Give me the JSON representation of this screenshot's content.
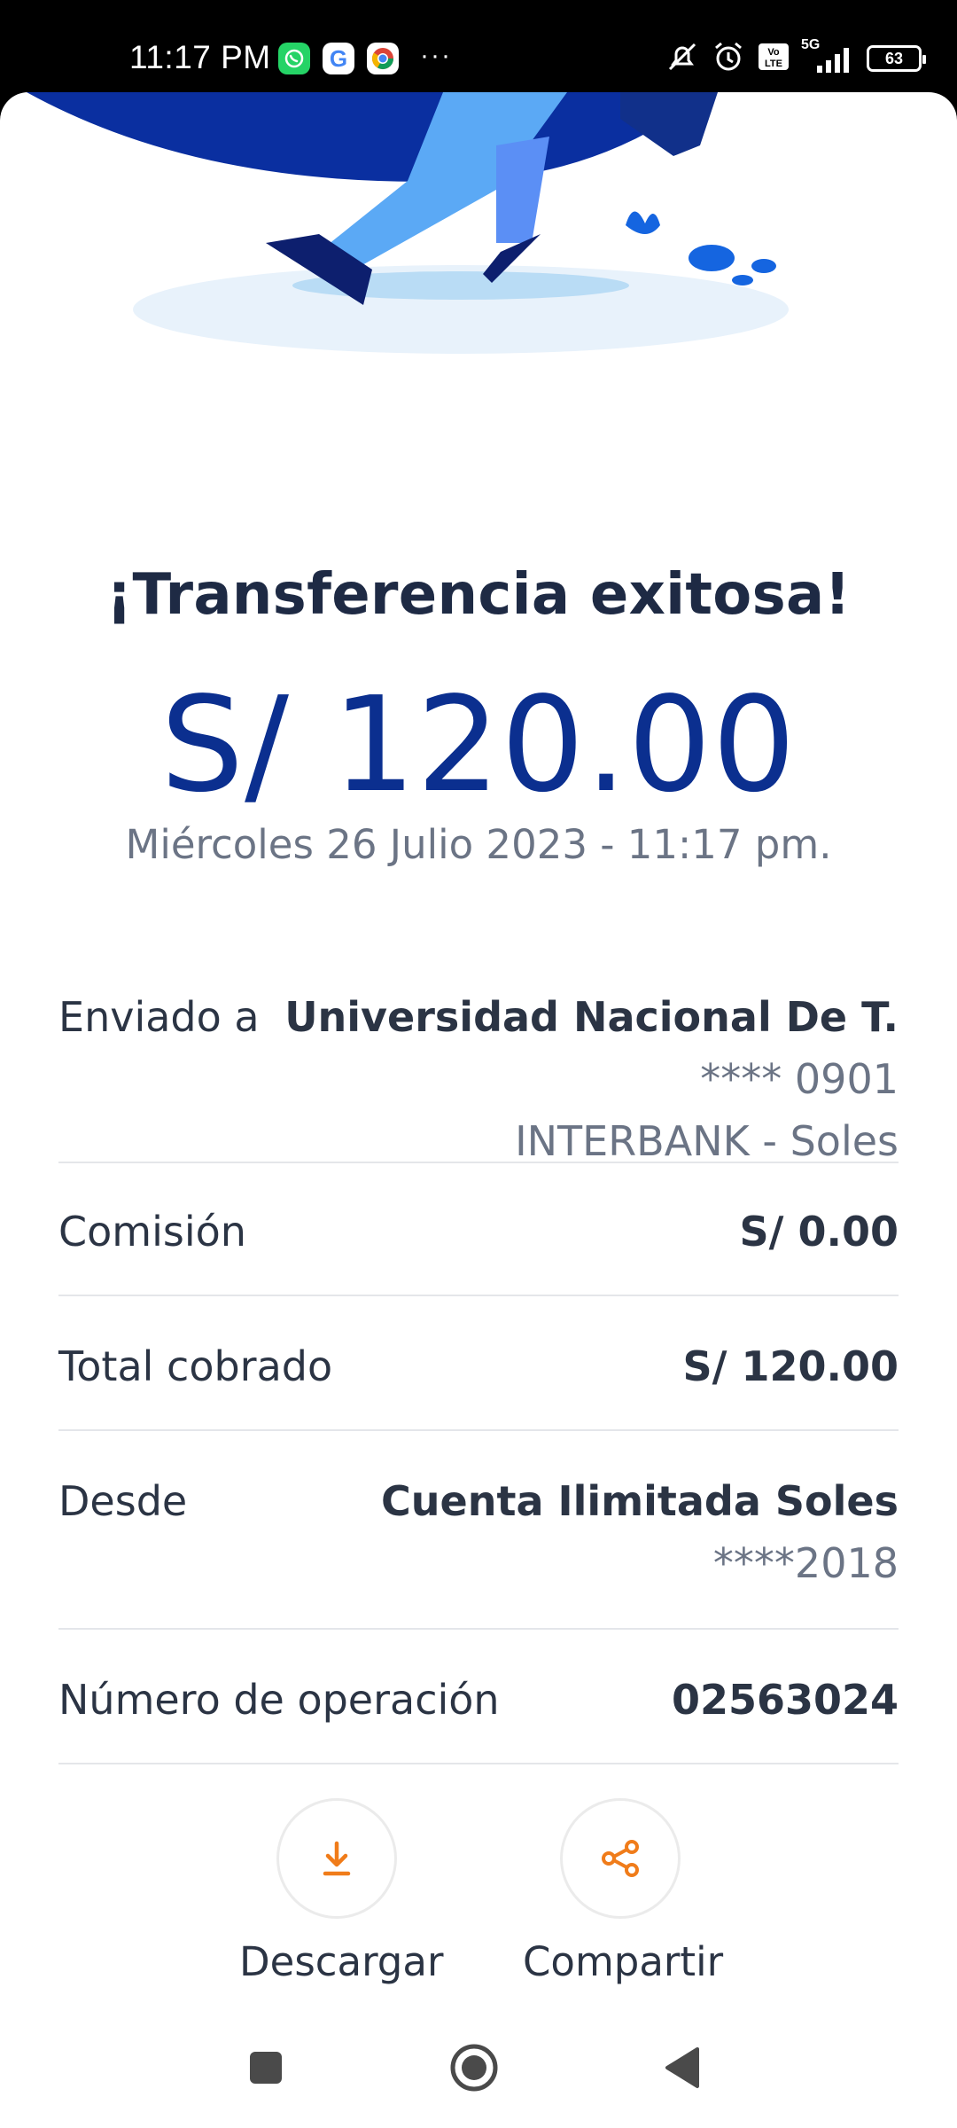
{
  "status_bar": {
    "time": "11:17 PM",
    "notifications": [
      "whatsapp-icon",
      "google-icon",
      "chrome-icon"
    ],
    "more": "···",
    "signal": "5G",
    "battery": "63"
  },
  "receipt": {
    "title": "¡Transferencia exitosa!",
    "amount": "S/ 120.00",
    "datetime": "Miércoles 26 Julio 2023 - 11:17 pm."
  },
  "details": {
    "sent_to": {
      "label": "Enviado a",
      "name": "Universidad Nacional De T.",
      "account": "**** 0901",
      "bank": "INTERBANK - Soles"
    },
    "commission": {
      "label": "Comisión",
      "value": "S/ 0.00"
    },
    "total": {
      "label": "Total cobrado",
      "value": "S/ 120.00"
    },
    "from": {
      "label": "Desde",
      "account_name": "Cuenta Ilimitada Soles",
      "account_number": "****2018"
    },
    "operation": {
      "label": "Número de operación",
      "value": "02563024"
    }
  },
  "actions": {
    "download": "Descargar",
    "share": "Compartir"
  },
  "colors": {
    "brand": "#0b2f8f",
    "accent": "#f07c1a",
    "text": "#2b3444",
    "muted": "#6b7485"
  }
}
